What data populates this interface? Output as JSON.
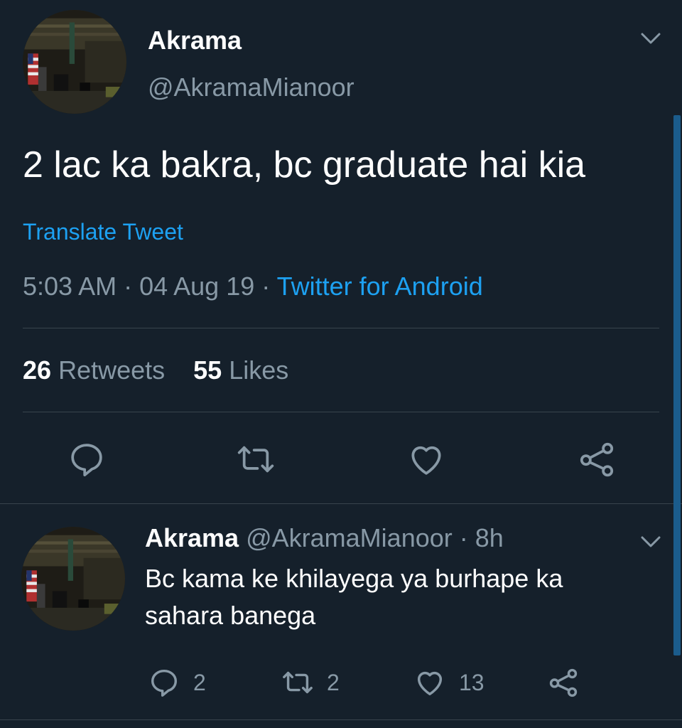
{
  "tweet": {
    "author_name": "Akrama",
    "author_handle": "@AkramaMianoor",
    "text": "2 lac ka bakra, bc graduate hai kia",
    "translate_label": "Translate Tweet",
    "time": "5:03 AM",
    "date": "04 Aug 19",
    "source": "Twitter for Android",
    "separator": " · ",
    "retweets_count": "26",
    "retweets_label": "Retweets",
    "likes_count": "55",
    "likes_label": "Likes",
    "actions": [
      "reply-icon",
      "retweet-icon",
      "like-icon",
      "share-icon"
    ]
  },
  "reply": {
    "author_name": "Akrama",
    "author_handle": "@AkramaMianoor",
    "age": "8h",
    "separator": " · ",
    "text": "Bc kama ke khilayega ya burhape ka sahara banega",
    "reply_count": "2",
    "retweet_count": "2",
    "like_count": "13"
  },
  "colors": {
    "background": "#15202b",
    "accent": "#1da1f2",
    "secondary_text": "#8899a6",
    "divider": "#38444d"
  }
}
